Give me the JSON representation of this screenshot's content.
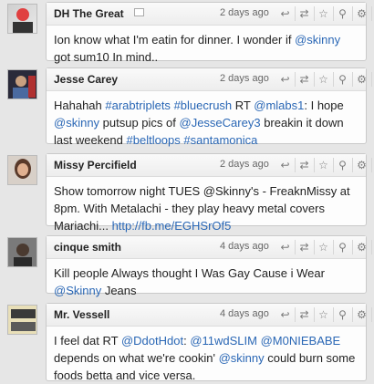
{
  "tweets": [
    {
      "user": "DH The Great",
      "time": "2 days ago",
      "text_parts": [
        {
          "t": "Ion know what I'm eatin for dinner. I wonder if ",
          "link": false
        },
        {
          "t": "@skinny",
          "link": true
        },
        {
          "t": " got sum10 In mind..",
          "link": false
        }
      ]
    },
    {
      "user": "Jesse Carey",
      "time": "2 days ago",
      "text_parts": [
        {
          "t": "Hahahah ",
          "link": false
        },
        {
          "t": "#arabtriplets",
          "link": true
        },
        {
          "t": " ",
          "link": false
        },
        {
          "t": "#bluecrush",
          "link": true
        },
        {
          "t": " RT ",
          "link": false
        },
        {
          "t": "@mlabs1",
          "link": true
        },
        {
          "t": ": I hope ",
          "link": false
        },
        {
          "t": "@skinny",
          "link": true
        },
        {
          "t": " putsup pics of ",
          "link": false
        },
        {
          "t": "@JesseCarey3",
          "link": true
        },
        {
          "t": " breakin it down last weekend ",
          "link": false
        },
        {
          "t": "#beltloops",
          "link": true
        },
        {
          "t": " ",
          "link": false
        },
        {
          "t": "#santamonica",
          "link": true
        }
      ]
    },
    {
      "user": "Missy Percifield",
      "time": "2 days ago",
      "text_parts": [
        {
          "t": "Show tomorrow night TUES @Skinny's - FreaknMissy at 8pm. With Metalachi - they play heavy metal covers Mariachi... ",
          "link": false
        },
        {
          "t": "http://fb.me/EGHSrOf5",
          "link": true
        }
      ]
    },
    {
      "user": "cinque smith",
      "time": "4 days ago",
      "text_parts": [
        {
          "t": "Kill people Always thought I Was Gay Cause i Wear ",
          "link": false
        },
        {
          "t": "@Skinny",
          "link": true
        },
        {
          "t": " Jeans",
          "link": false
        }
      ]
    },
    {
      "user": "Mr. Vessell",
      "time": "4 days ago",
      "text_parts": [
        {
          "t": "I feel dat RT ",
          "link": false
        },
        {
          "t": "@DdotHdot",
          "link": true
        },
        {
          "t": ": ",
          "link": false
        },
        {
          "t": "@11wdSLIM",
          "link": true
        },
        {
          "t": " ",
          "link": false
        },
        {
          "t": "@M0NIEBABE",
          "link": true
        },
        {
          "t": " depends on what we're cookin' ",
          "link": false
        },
        {
          "t": "@skinny",
          "link": true
        },
        {
          "t": " could burn some foods betta and vice versa.",
          "link": false
        }
      ]
    }
  ],
  "icons": [
    "reply-icon",
    "retweet-icon",
    "favorite-icon",
    "user-icon",
    "settings-icon",
    "compose-icon"
  ]
}
